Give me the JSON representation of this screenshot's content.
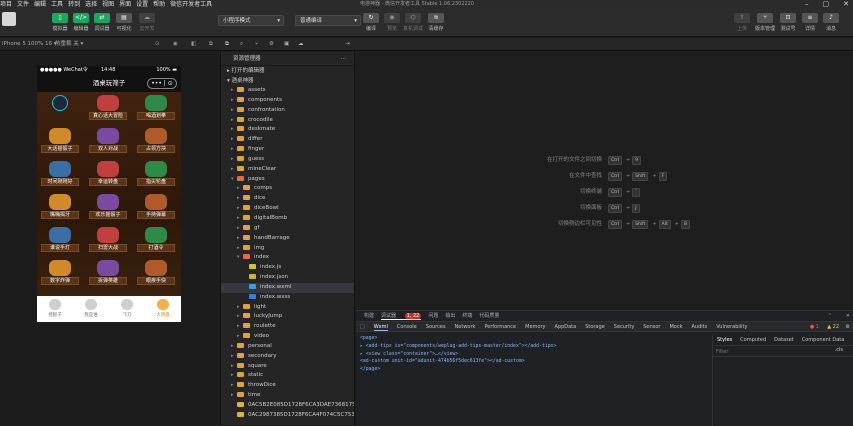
{
  "menubar": {
    "items": [
      "项目",
      "文件",
      "编辑",
      "工具",
      "转到",
      "选择",
      "视图",
      "界面",
      "设置",
      "帮助",
      "微信开发者工具"
    ],
    "title": "电游神器 - 微信开发者工具 Stable 1.06.2302220"
  },
  "toolbar": {
    "simulator": "模拟器",
    "editor": "编辑器",
    "debugger": "调试器",
    "visual": "可视化",
    "cloud": "云开发",
    "mode_select": "小程序模式",
    "compile_select": "普通编译",
    "compile": "编译",
    "preview": "预览",
    "real_debug": "真机调试",
    "clear_cache": "清缓存",
    "upload": "上传",
    "version": "版本管理",
    "test": "测试号",
    "details": "详情",
    "messages": "消息"
  },
  "subbar": {
    "device": "iPhone 5 100% 16 ▾",
    "hotreload": "热重载 关 ▾"
  },
  "phone": {
    "signal": "●●●●● WeChat令",
    "time": "14:48",
    "battery": "100%",
    "nav_title": "酒桌玩筛子",
    "capsule_dots": "•••",
    "capsule_close": "⊙",
    "grid": [
      {
        "label": "",
        "badge": ""
      },
      {
        "label": "真心话大冒险",
        "badge": ""
      },
      {
        "label": "喝酒划拳",
        "badge": ""
      },
      {
        "label": "大话摇骰子",
        "badge": ""
      },
      {
        "label": "双人对战",
        "badge": ""
      },
      {
        "label": "占领方块",
        "badge": ""
      },
      {
        "label": "时间刚刚好",
        "badge": ""
      },
      {
        "label": "幸运转盘",
        "badge": ""
      },
      {
        "label": "指尖轮盘",
        "badge": ""
      },
      {
        "label": "嘴嗨揭牙",
        "badge": ""
      },
      {
        "label": "欢乐摇骰子",
        "badge": ""
      },
      {
        "label": "手持弹幕",
        "badge": ""
      },
      {
        "label": "谁说手灯",
        "badge": ""
      },
      {
        "label": "扫雷大战",
        "badge": ""
      },
      {
        "label": "打酒令",
        "badge": ""
      },
      {
        "label": "数字炸弹",
        "badge": ""
      },
      {
        "label": "拆弹英雄",
        "badge": ""
      },
      {
        "label": "眼疾手快",
        "badge": ""
      }
    ],
    "tabs": [
      "摇骰子",
      "我是谁",
      "飞刀",
      "大转盘"
    ]
  },
  "explorer": {
    "title": "资源管理器",
    "more": "···",
    "open_editors": "打开的编辑器",
    "project": "酒桌神器",
    "tree": [
      {
        "name": "assets",
        "depth": 1,
        "type": "folder"
      },
      {
        "name": "components",
        "depth": 1,
        "type": "folder"
      },
      {
        "name": "confrontation",
        "depth": 1,
        "type": "folder"
      },
      {
        "name": "crocodile",
        "depth": 1,
        "type": "folder"
      },
      {
        "name": "deskmate",
        "depth": 1,
        "type": "folder"
      },
      {
        "name": "differ",
        "depth": 1,
        "type": "folder"
      },
      {
        "name": "finger",
        "depth": 1,
        "type": "folder"
      },
      {
        "name": "guess",
        "depth": 1,
        "type": "folder"
      },
      {
        "name": "mineClear",
        "depth": 1,
        "type": "folder"
      },
      {
        "name": "pages",
        "depth": 1,
        "type": "folder-open"
      },
      {
        "name": "comps",
        "depth": 2,
        "type": "folder"
      },
      {
        "name": "dice",
        "depth": 2,
        "type": "folder"
      },
      {
        "name": "diceBowl",
        "depth": 2,
        "type": "folder"
      },
      {
        "name": "digitalBomb",
        "depth": 2,
        "type": "folder"
      },
      {
        "name": "gf",
        "depth": 2,
        "type": "folder"
      },
      {
        "name": "handBarrage",
        "depth": 2,
        "type": "folder"
      },
      {
        "name": "img",
        "depth": 2,
        "type": "folder"
      },
      {
        "name": "index",
        "depth": 2,
        "type": "folder-open"
      },
      {
        "name": "index.js",
        "depth": 3,
        "type": "js"
      },
      {
        "name": "index.json",
        "depth": 3,
        "type": "json"
      },
      {
        "name": "index.wxml",
        "depth": 3,
        "type": "wxml"
      },
      {
        "name": "index.wxss",
        "depth": 3,
        "type": "wxss"
      },
      {
        "name": "light",
        "depth": 2,
        "type": "folder"
      },
      {
        "name": "luckyJump",
        "depth": 2,
        "type": "folder"
      },
      {
        "name": "roulette",
        "depth": 2,
        "type": "folder"
      },
      {
        "name": "video",
        "depth": 2,
        "type": "folder"
      },
      {
        "name": "personal",
        "depth": 1,
        "type": "folder"
      },
      {
        "name": "secondary",
        "depth": 1,
        "type": "folder"
      },
      {
        "name": "square",
        "depth": 1,
        "type": "folder"
      },
      {
        "name": "static",
        "depth": 1,
        "type": "folder"
      },
      {
        "name": "throwDice",
        "depth": 1,
        "type": "folder"
      },
      {
        "name": "time",
        "depth": 1,
        "type": "folder"
      },
      {
        "name": "0AC5B2E085D1728F6CA3DAE73681753...",
        "depth": 1,
        "type": "img"
      },
      {
        "name": "0AC2987385D1728F6CA4F074C5C7533...",
        "depth": 1,
        "type": "img"
      }
    ]
  },
  "editor": {
    "hints": [
      {
        "text": "在打开的文件之间切换",
        "keys": [
          "Ctrl",
          "+",
          "9"
        ]
      },
      {
        "text": "在文件中查找",
        "keys": [
          "Ctrl",
          "+",
          "Shift",
          "+",
          "F"
        ]
      },
      {
        "text": "切换终端",
        "keys": [
          "Ctrl",
          "+",
          "`"
        ]
      },
      {
        "text": "切换面板",
        "keys": [
          "Ctrl",
          "+",
          "J"
        ]
      },
      {
        "text": "切换侧边栏可见性",
        "keys": [
          "Ctrl",
          "+",
          "Shift",
          "+",
          "Alt",
          "+",
          "B"
        ]
      }
    ]
  },
  "devtools": {
    "tabs1": [
      "构建",
      "调试器",
      "问题",
      "输出",
      "终端",
      "代码质量"
    ],
    "debugger_badge": "1, 22",
    "tabs2": [
      "Wxml",
      "Console",
      "Sources",
      "Network",
      "Performance",
      "Memory",
      "AppData",
      "Storage",
      "Security",
      "Sensor",
      "Mock",
      "Audits",
      "Vulnerability"
    ],
    "errors": "● 1",
    "warnings": "▲ 22",
    "code": [
      "<page>",
      "▸ <add-tips is=\"components/weplug-add-tips-master/index\"></add-tips>",
      "▸ <view class=\"container\">…</view>",
      "  <ad-custom unit-id=\"adunit-474b56f5dec613fe\"></ad-custom>",
      "</page>"
    ],
    "style_tabs": [
      "Styles",
      "Computed",
      "Dataset",
      "Component Data"
    ],
    "filter_placeholder": "Filter",
    "cls": ".cls"
  }
}
